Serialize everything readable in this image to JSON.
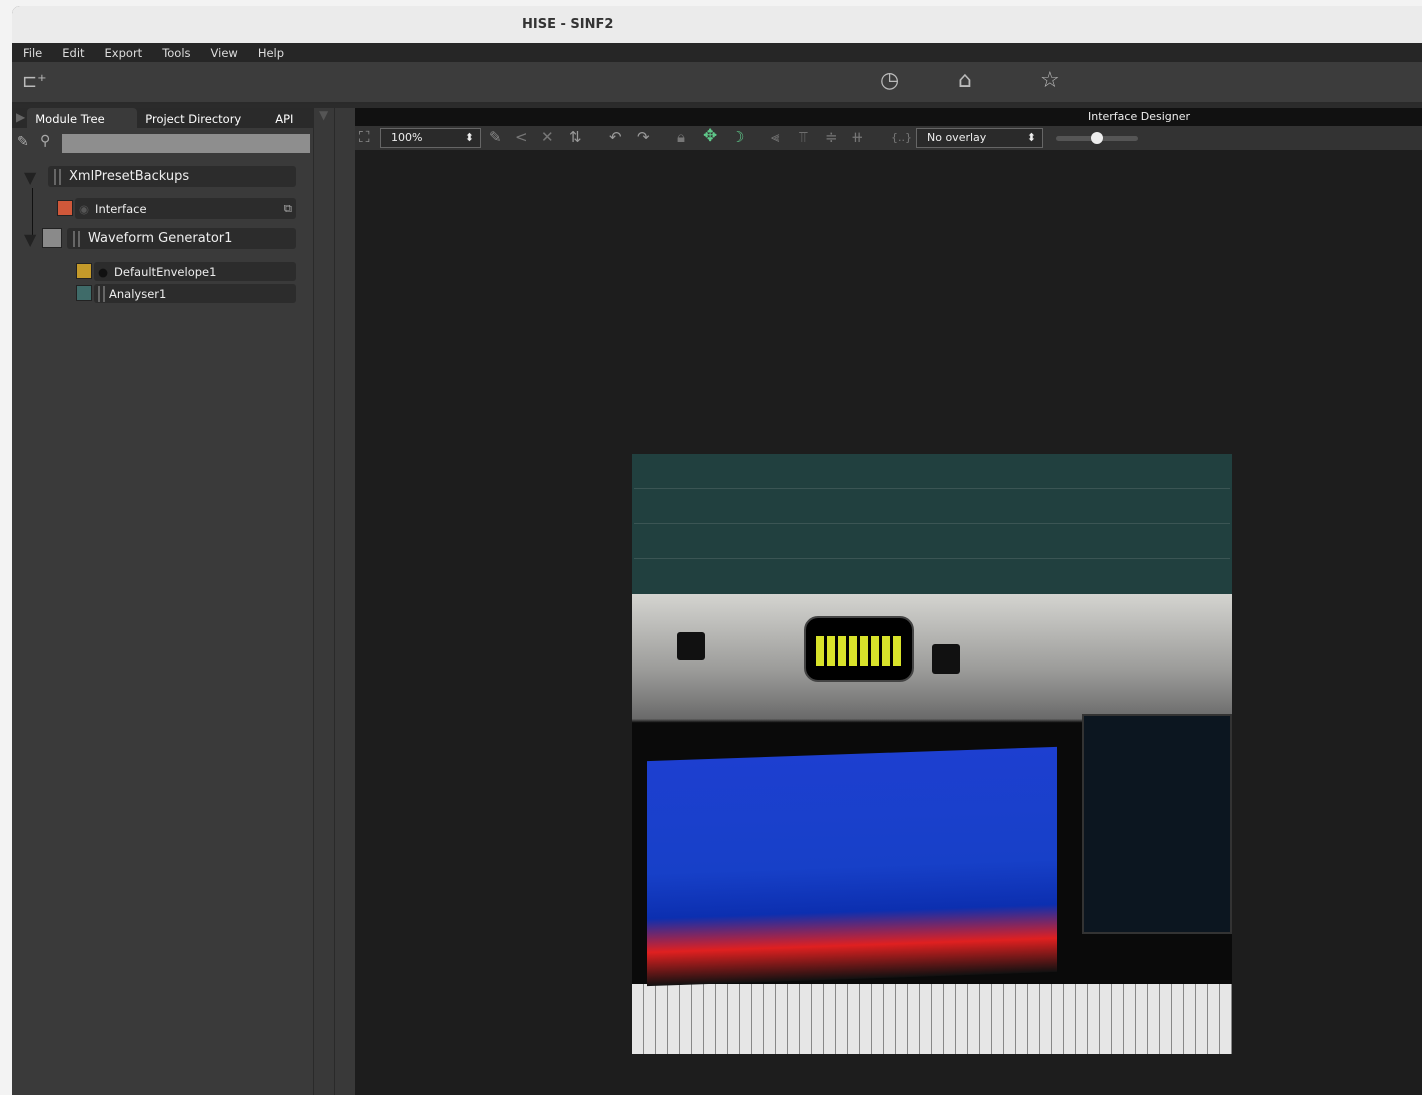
{
  "window": {
    "title": "HISE - SINF2"
  },
  "menu": [
    "File",
    "Edit",
    "Export",
    "Tools",
    "View",
    "Help"
  ],
  "toolbar": {
    "icons": [
      "new-panel-icon",
      "gauge-icon",
      "home-icon",
      "star-icon"
    ]
  },
  "left_panel": {
    "tabs": [
      "Module Tree",
      "Project Directory",
      "API"
    ],
    "search": {
      "value": "",
      "placeholder": ""
    },
    "tree": [
      {
        "label": "XmlPresetBackups",
        "color": null
      },
      {
        "label": "Interface",
        "color": "#d0583a"
      },
      {
        "label": "Waveform Generator1",
        "color": "#8a8a8a"
      },
      {
        "label": "DefaultEnvelope1",
        "color": "#c49a2a"
      },
      {
        "label": "Analyser1",
        "color": "#3f6b69"
      }
    ]
  },
  "designer": {
    "title": "Interface Designer",
    "zoom": "100%",
    "overlay": "No overlay",
    "slider_value": 0.5,
    "accent": "#5fc98a"
  }
}
